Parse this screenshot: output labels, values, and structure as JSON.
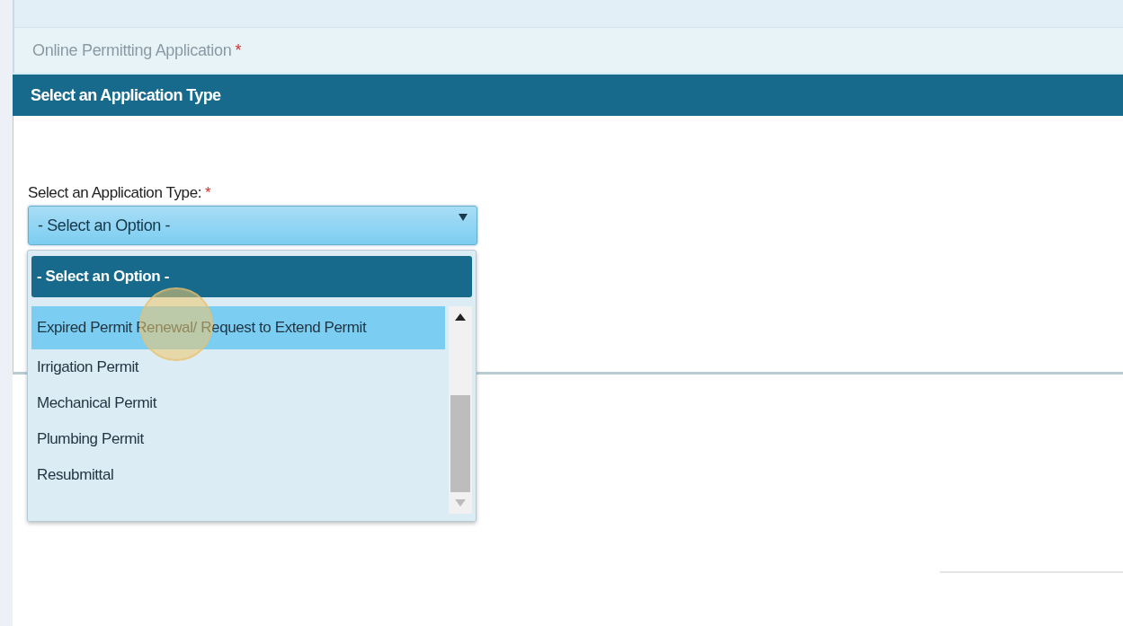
{
  "steps": [
    {
      "label": "Online Permitting Application",
      "required_mark": "*"
    }
  ],
  "section": {
    "title": "Select an Application Type"
  },
  "field": {
    "label": "Select an Application Type:",
    "required_mark": "*",
    "value": "- Select an Option -",
    "expanded": true,
    "options": [
      {
        "label": "- Select an Option -",
        "selected": true,
        "hovered": false
      },
      {
        "label": "Expired Permit Renewal/ Request to Extend Permit",
        "selected": false,
        "hovered": true
      },
      {
        "label": "Irrigation Permit",
        "selected": false,
        "hovered": false
      },
      {
        "label": "Mechanical Permit",
        "selected": false,
        "hovered": false
      },
      {
        "label": "Plumbing Permit",
        "selected": false,
        "hovered": false
      },
      {
        "label": "Resubmittal",
        "selected": false,
        "hovered": false
      }
    ]
  }
}
